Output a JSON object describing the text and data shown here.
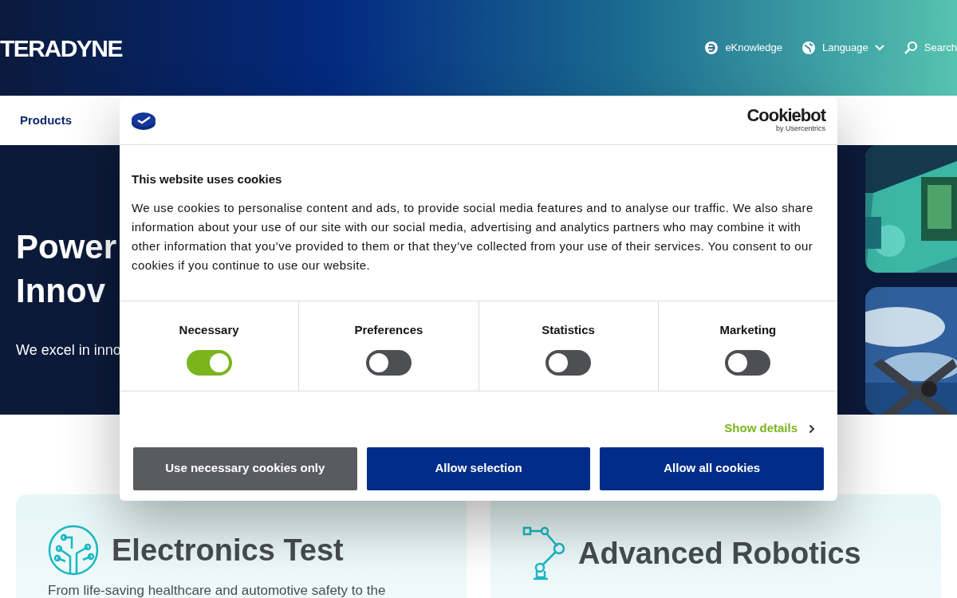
{
  "header": {
    "logo": "TERADYNE",
    "links": [
      {
        "kind": "eknowledge",
        "label": "eKnowledge"
      },
      {
        "kind": "language",
        "label": "Language"
      },
      {
        "kind": "search",
        "label": "Search"
      }
    ]
  },
  "nav": {
    "items": [
      "Products"
    ]
  },
  "hero": {
    "title_lines": [
      "Power",
      "Innov"
    ],
    "subtitle": "We excel in inno"
  },
  "cards": [
    {
      "kind": "circuit",
      "title": "Electronics Test",
      "text": "From life-saving healthcare and automotive safety to the"
    },
    {
      "kind": "robot",
      "title": "Advanced Robotics"
    }
  ],
  "cookie_dialog": {
    "brand": "Cookiebot",
    "brand_sub": "by Usercentrics",
    "heading": "This website uses cookies",
    "body": "We use cookies to personalise content and ads, to provide social media features and to analyse our traffic. We also share information about your use of our site with our social media, advertising and analytics partners who may combine it with other information that you’ve provided to them or that they’ve collected from your use of their services. You consent to our cookies if you continue to use our website.",
    "categories": [
      {
        "label": "Necessary",
        "on": true
      },
      {
        "label": "Preferences",
        "on": false
      },
      {
        "label": "Statistics",
        "on": false
      },
      {
        "label": "Marketing",
        "on": false
      }
    ],
    "details_link": "Show details",
    "buttons": [
      {
        "kind": "secondary",
        "label": "Use necessary cookies only"
      },
      {
        "kind": "primary",
        "label": "Allow selection"
      },
      {
        "kind": "primary",
        "label": "Allow all cookies"
      }
    ]
  }
}
